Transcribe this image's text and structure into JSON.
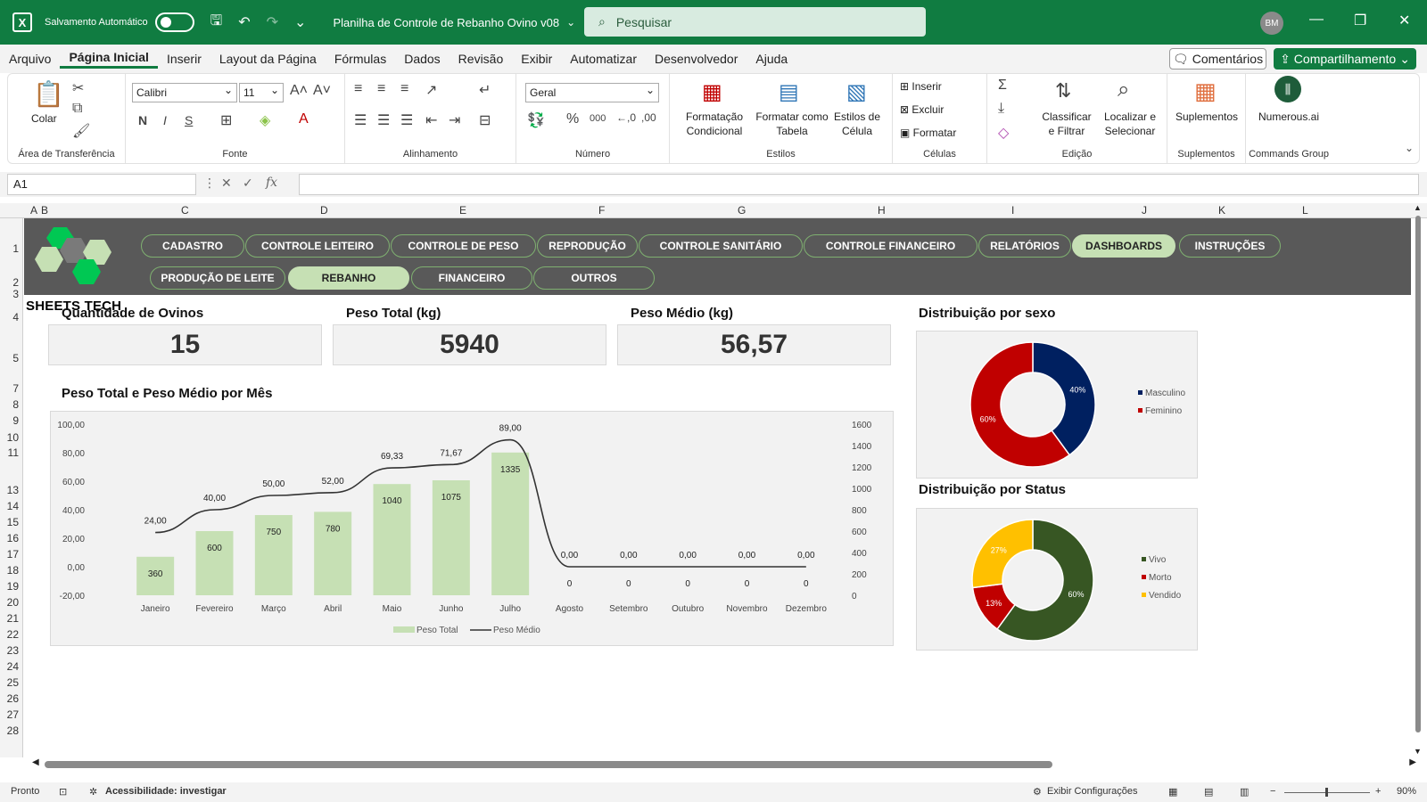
{
  "titlebar": {
    "autosave_label": "Salvamento Automático",
    "doc_title": "Planilha de Controle de Rebanho Ovino v08",
    "search_placeholder": "Pesquisar",
    "user_initials": "BM"
  },
  "menu": {
    "items": [
      "Arquivo",
      "Página Inicial",
      "Inserir",
      "Layout da Página",
      "Fórmulas",
      "Dados",
      "Revisão",
      "Exibir",
      "Automatizar",
      "Desenvolvedor",
      "Ajuda"
    ],
    "active": "Página Inicial",
    "comments_label": "Comentários",
    "share_label": "Compartilhamento"
  },
  "ribbon": {
    "clipboard": {
      "label": "Área de Transferência",
      "paste": "Colar"
    },
    "font": {
      "label": "Fonte",
      "name": "Calibri",
      "size": "11",
      "bold": "N",
      "italic": "I",
      "underline": "S"
    },
    "alignment": {
      "label": "Alinhamento"
    },
    "number": {
      "label": "Número",
      "format": "Geral"
    },
    "styles": {
      "label": "Estilos",
      "cond1": "Formatação",
      "cond2": "Condicional",
      "table1": "Formatar como",
      "table2": "Tabela",
      "cell1": "Estilos de",
      "cell2": "Célula"
    },
    "cells": {
      "label": "Células",
      "insert": "Inserir",
      "delete": "Excluir",
      "format": "Formatar"
    },
    "editing": {
      "label": "Edição",
      "sort1": "Classificar",
      "sort2": "e Filtrar",
      "find1": "Localizar e",
      "find2": "Selecionar"
    },
    "addins": {
      "label": "Suplementos",
      "btn": "Suplementos"
    },
    "commands": {
      "label": "Commands Group",
      "btn": "Numerous.ai"
    }
  },
  "formula": {
    "namebox": "A1",
    "fx": "fx"
  },
  "columns": [
    "A",
    "B",
    "C",
    "D",
    "E",
    "F",
    "G",
    "H",
    "I",
    "J",
    "K",
    "L"
  ],
  "rows": [
    "1",
    "2",
    "3",
    "4",
    "5",
    "7",
    "8",
    "9",
    "10",
    "11",
    "13",
    "14",
    "15",
    "16",
    "17",
    "18",
    "19",
    "20",
    "21",
    "22",
    "23",
    "24",
    "25",
    "26",
    "27",
    "28"
  ],
  "nav": {
    "row1": [
      "CADASTRO",
      "CONTROLE LEITEIRO",
      "CONTROLE DE PESO",
      "REPRODUÇÃO",
      "CONTROLE SANITÁRIO",
      "CONTROLE FINANCEIRO",
      "RELATÓRIOS",
      "DASHBOARDS",
      "INSTRUÇÕES"
    ],
    "row2": [
      "PRODUÇÃO DE LEITE",
      "REBANHO",
      "FINANCEIRO",
      "OUTROS"
    ],
    "active_row1": "DASHBOARDS",
    "active_row2": "REBANHO"
  },
  "brand": "SHEETS TECH",
  "kpis": [
    {
      "title": "Quantidade de Ovinos",
      "value": "15"
    },
    {
      "title": "Peso Total (kg)",
      "value": "5940"
    },
    {
      "title": "Peso Médio (kg)",
      "value": "56,57"
    }
  ],
  "colors": {
    "bar": "#c6e0b4",
    "line": "#333333",
    "masc": "#002060",
    "fem": "#c00000",
    "vivo": "#375623",
    "morto": "#c00000",
    "vendido": "#ffc000"
  },
  "chart_data": [
    {
      "type": "bar",
      "title": "Peso Total e Peso Médio por Mês",
      "categories": [
        "Janeiro",
        "Fevereiro",
        "Março",
        "Abril",
        "Maio",
        "Junho",
        "Julho",
        "Agosto",
        "Setembro",
        "Outubro",
        "Novembro",
        "Dezembro"
      ],
      "series": [
        {
          "name": "Peso Total",
          "type": "bar",
          "axis": "right",
          "values": [
            360,
            600,
            750,
            780,
            1040,
            1075,
            1335,
            0,
            0,
            0,
            0,
            0
          ],
          "labels": [
            "360",
            "600",
            "750",
            "780",
            "1040",
            "1075",
            "1335",
            "0",
            "0",
            "0",
            "0",
            "0"
          ]
        },
        {
          "name": "Peso Médio",
          "type": "line",
          "axis": "left",
          "values": [
            24,
            40,
            50,
            52,
            69.33,
            71.67,
            89,
            0,
            0,
            0,
            0,
            0
          ],
          "labels": [
            "24,00",
            "40,00",
            "50,00",
            "52,00",
            "69,33",
            "71,67",
            "89,00",
            "0,00",
            "0,00",
            "0,00",
            "0,00",
            "0,00"
          ]
        }
      ],
      "left_axis": {
        "ylim": [
          -20,
          100
        ],
        "ticks": [
          "-20,00",
          "0,00",
          "20,00",
          "40,00",
          "60,00",
          "80,00",
          "100,00"
        ]
      },
      "right_axis": {
        "ylim": [
          0,
          1600
        ],
        "ticks": [
          "0",
          "200",
          "400",
          "600",
          "800",
          "1000",
          "1200",
          "1400",
          "1600"
        ]
      },
      "legend": "bottom",
      "grid": false
    },
    {
      "type": "pie",
      "title": "Distribuição por sexo",
      "categories": [
        "Masculino",
        "Feminino"
      ],
      "values": [
        40,
        60
      ],
      "labels": [
        "40%",
        "60%"
      ],
      "legend": "right"
    },
    {
      "type": "pie",
      "title": "Distribuição por Status",
      "categories": [
        "Vivo",
        "Morto",
        "Vendido"
      ],
      "values": [
        60,
        13,
        27
      ],
      "labels": [
        "60%",
        "13%",
        "27%"
      ],
      "legend": "right"
    }
  ],
  "status": {
    "ready": "Pronto",
    "accessibility": "Acessibilidade: investigar",
    "display_settings": "Exibir Configurações",
    "zoom": "90%"
  }
}
